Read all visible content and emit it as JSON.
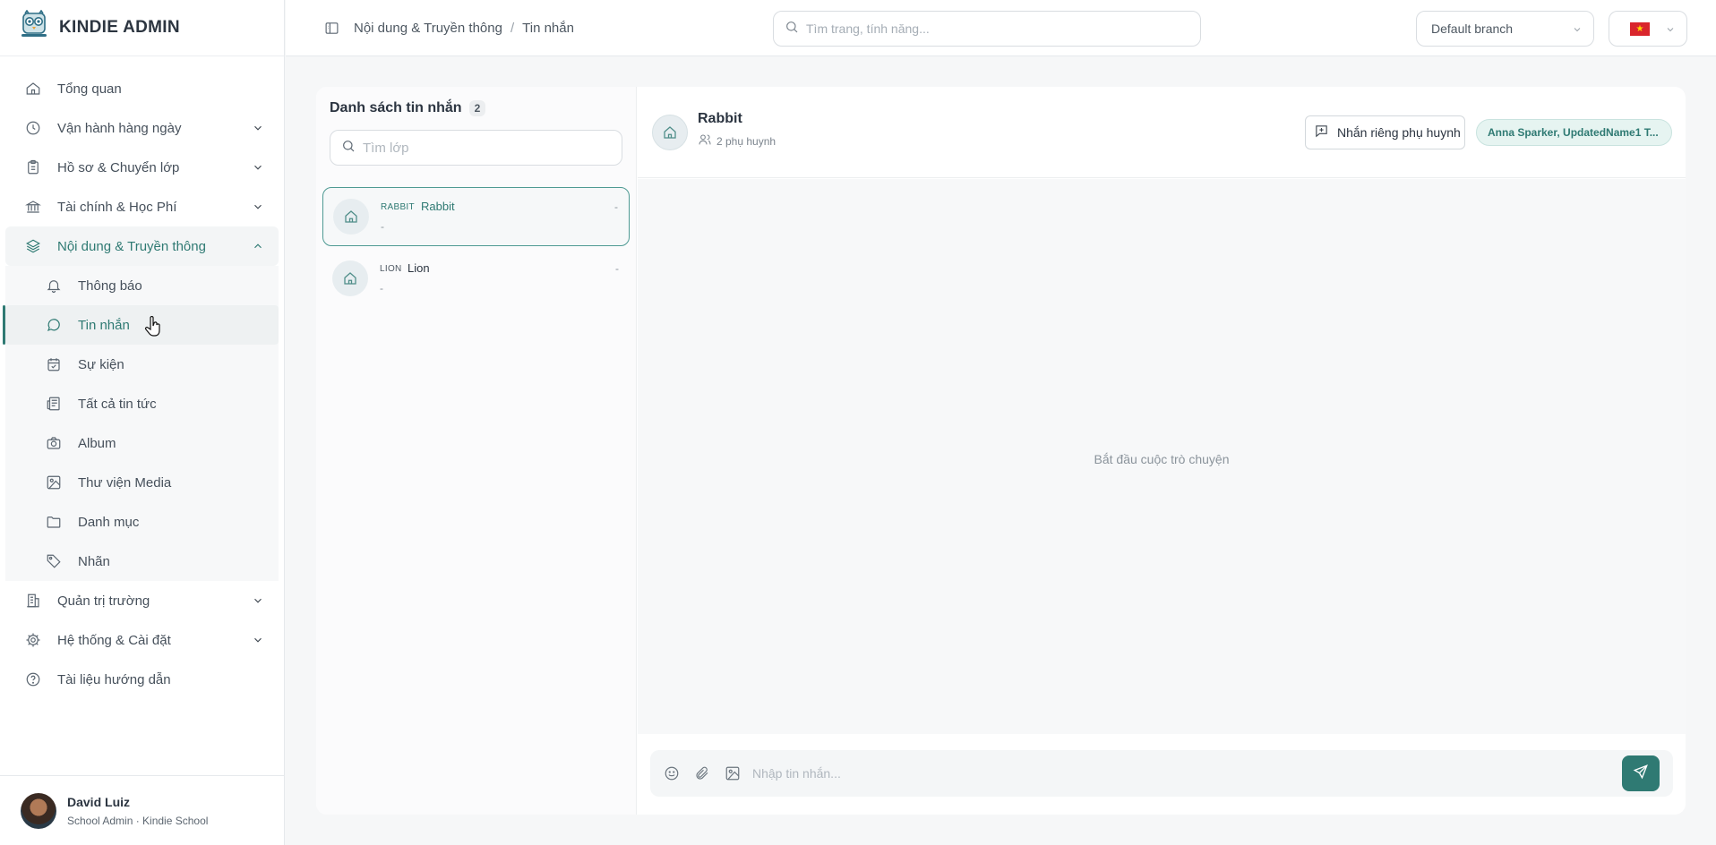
{
  "brand": {
    "name": "KINDIE ADMIN",
    "logo_icon": "owl-logo-icon"
  },
  "sidebar": {
    "items": [
      {
        "label": "Tổng quan",
        "icon": "home-icon"
      },
      {
        "label": "Vận hành hàng ngày",
        "icon": "clock-icon"
      },
      {
        "label": "Hồ sơ & Chuyển lớp",
        "icon": "clipboard-icon"
      },
      {
        "label": "Tài chính & Học Phí",
        "icon": "bank-icon"
      },
      {
        "label": "Nội dung & Truyền thông",
        "icon": "layers-icon"
      },
      {
        "label": "Quản trị trường",
        "icon": "building-icon"
      },
      {
        "label": "Hệ thống & Cài đặt",
        "icon": "gear-icon"
      },
      {
        "label": "Tài liệu hướng dẫn",
        "icon": "help-circle-icon"
      }
    ],
    "sub_items": [
      {
        "label": "Thông báo",
        "icon": "bell-icon"
      },
      {
        "label": "Tin nhắn",
        "icon": "message-circle-icon"
      },
      {
        "label": "Sự kiện",
        "icon": "calendar-check-icon"
      },
      {
        "label": "Tất cả tin tức",
        "icon": "newspaper-icon"
      },
      {
        "label": "Album",
        "icon": "camera-icon"
      },
      {
        "label": "Thư viện Media",
        "icon": "image-icon"
      },
      {
        "label": "Danh mục",
        "icon": "folder-icon"
      },
      {
        "label": "Nhãn",
        "icon": "tag-icon"
      }
    ]
  },
  "user": {
    "name": "David Luiz",
    "role": "School Admin · Kindie School"
  },
  "topbar": {
    "breadcrumb": [
      "Nội dung & Truyền thông",
      "/",
      "Tin nhắn"
    ],
    "search_placeholder": "Tìm trang, tính năng...",
    "branch": "Default branch",
    "language_flag": "vietnam-flag-icon"
  },
  "message_list": {
    "title": "Danh sách tin nhắn",
    "count": "2",
    "search_placeholder": "Tìm lớp",
    "rooms": [
      {
        "code": "RABBIT",
        "name": "Rabbit",
        "preview": "-",
        "time": "-",
        "selected": true
      },
      {
        "code": "LION",
        "name": "Lion",
        "preview": "-",
        "time": "-",
        "selected": false
      }
    ]
  },
  "chat": {
    "name": "Rabbit",
    "members": "2 phụ huynh",
    "dm_button": "Nhắn riêng phụ huynh",
    "parents": "Anna Sparker, UpdatedName1 T...",
    "empty_state": "Bắt đầu cuộc trò chuyện",
    "input_placeholder": "Nhập tin nhắn..."
  },
  "colors": {
    "accent": "#2f7a73",
    "background": "#f6f7f8"
  }
}
